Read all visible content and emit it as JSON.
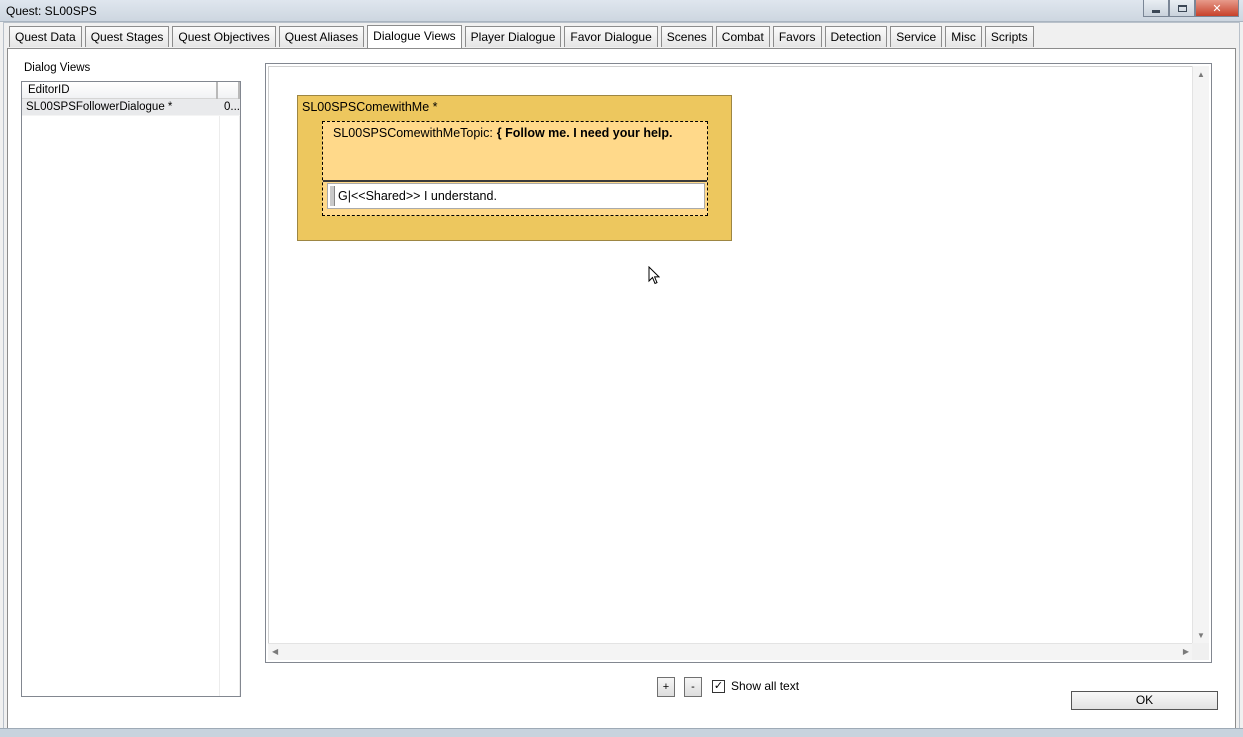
{
  "window": {
    "title": "Quest: SL00SPS",
    "minimize_glyph": "",
    "maximize_glyph": "",
    "close_glyph": "✕"
  },
  "tabs": [
    {
      "label": "Quest Data",
      "active": false
    },
    {
      "label": "Quest Stages",
      "active": false
    },
    {
      "label": "Quest Objectives",
      "active": false
    },
    {
      "label": "Quest Aliases",
      "active": false
    },
    {
      "label": "Dialogue Views",
      "active": true
    },
    {
      "label": "Player Dialogue",
      "active": false
    },
    {
      "label": "Favor Dialogue",
      "active": false
    },
    {
      "label": "Scenes",
      "active": false
    },
    {
      "label": "Combat",
      "active": false
    },
    {
      "label": "Favors",
      "active": false
    },
    {
      "label": "Detection",
      "active": false
    },
    {
      "label": "Service",
      "active": false
    },
    {
      "label": "Misc",
      "active": false
    },
    {
      "label": "Scripts",
      "active": false
    }
  ],
  "dialog_views": {
    "label": "Dialog Views",
    "columns": [
      "EditorID",
      ""
    ],
    "rows": [
      {
        "editor_id": "SL00SPSFollowerDialogue *",
        "col2": "0..."
      }
    ]
  },
  "canvas": {
    "branch": {
      "title": "SL00SPSComewithMe *",
      "topic": {
        "name": "SL00SPSComewithMeTopic:",
        "prompt": "{ Follow me. I need your help.",
        "response": "G|<<Shared>> I understand."
      }
    }
  },
  "controls": {
    "zoom_in_label": "+",
    "zoom_out_label": "-",
    "show_all_text_label": "Show all text",
    "show_all_text_checked": true,
    "check_glyph": "✓",
    "ok_label": "OK"
  },
  "icons": {
    "scroll_up": "▲",
    "scroll_down": "▼",
    "scroll_left": "◀",
    "scroll_right": "▶",
    "cursor": "mouse-pointer-icon"
  }
}
